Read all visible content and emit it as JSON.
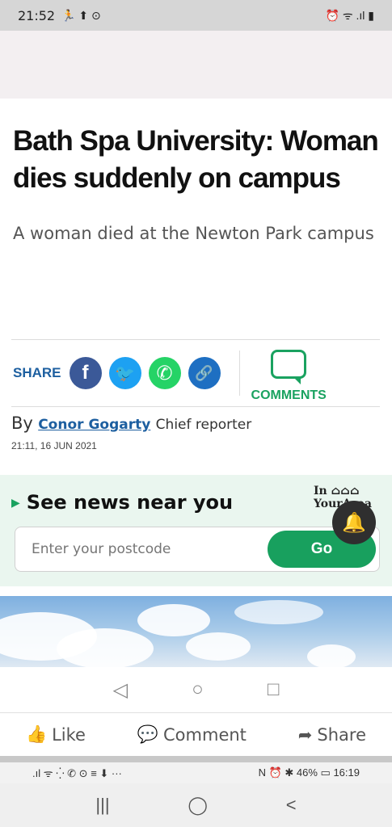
{
  "status_top": {
    "time": "21:52",
    "left_icons": "🏃 ⬆ ⊙",
    "right_icons": "⏰ ᯤ .ıl ▮"
  },
  "article": {
    "headline": "Bath Spa University: Woman dies suddenly on campus",
    "standfirst": "A woman died at the Newton Park campus"
  },
  "share": {
    "label": "SHARE",
    "facebook_glyph": "f",
    "twitter_glyph": "🐦",
    "whatsapp_glyph": "✆",
    "link_glyph": "🔗",
    "comments_label": "COMMENTS"
  },
  "byline": {
    "by": "By",
    "author": "Conor Gogarty",
    "role": "Chief reporter",
    "timestamp": "21:11, 16 JUN 2021"
  },
  "near_you": {
    "title": "See news near you",
    "logo_line1": "In ⌂⌂⌂",
    "logo_line2": "YourArea",
    "placeholder": "Enter your postcode",
    "go_label": "Go"
  },
  "browser_nav": {
    "back": "◁",
    "home": "○",
    "recent": "□"
  },
  "social_bar": {
    "like": "Like",
    "comment": "Comment",
    "share": "Share"
  },
  "status_bottom": {
    "left": ".ıl ᯤ ⁛ ✆ ⊙ ≡ ⬇ ···",
    "right": "N ⏰ ✱ 46% ▭ 16:19"
  },
  "system_nav": {
    "recents": "|||",
    "home": "◯",
    "back": "<"
  },
  "colors": {
    "accent_blue": "#1d5fa0",
    "accent_green": "#1aa260"
  }
}
